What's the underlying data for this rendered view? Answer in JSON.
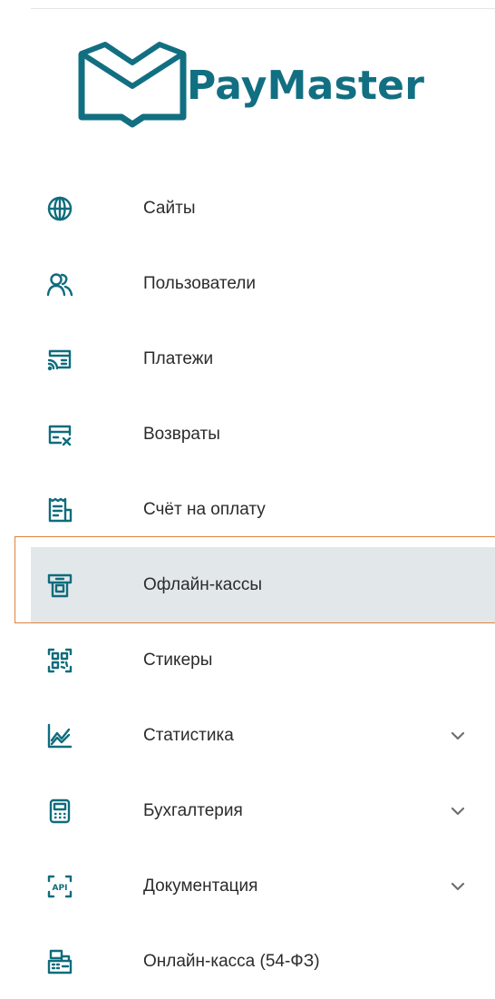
{
  "brand": {
    "name": "PayMaster",
    "color": "#126f82"
  },
  "accent_color": "#0f6c7c",
  "active_highlight_color": "#e2e7ea",
  "focus_outline_color": "#e0823a",
  "menu": {
    "items": [
      {
        "label": "Сайты",
        "icon": "globe-icon"
      },
      {
        "label": "Пользователи",
        "icon": "users-icon"
      },
      {
        "label": "Платежи",
        "icon": "payments-icon"
      },
      {
        "label": "Возвраты",
        "icon": "refund-card-icon"
      },
      {
        "label": "Счёт на оплату",
        "icon": "invoice-icon"
      },
      {
        "label": "Офлайн-кассы",
        "icon": "terminal-icon",
        "active": true
      },
      {
        "label": "Стикеры",
        "icon": "qr-sticker-icon"
      },
      {
        "label": "Статистика",
        "icon": "chart-icon",
        "expandable": true
      },
      {
        "label": "Бухгалтерия",
        "icon": "calculator-icon",
        "expandable": true
      },
      {
        "label": "Документация",
        "icon": "api-icon",
        "expandable": true
      },
      {
        "label": "Онлайн-касса (54-ФЗ)",
        "icon": "cash-register-icon"
      }
    ]
  }
}
